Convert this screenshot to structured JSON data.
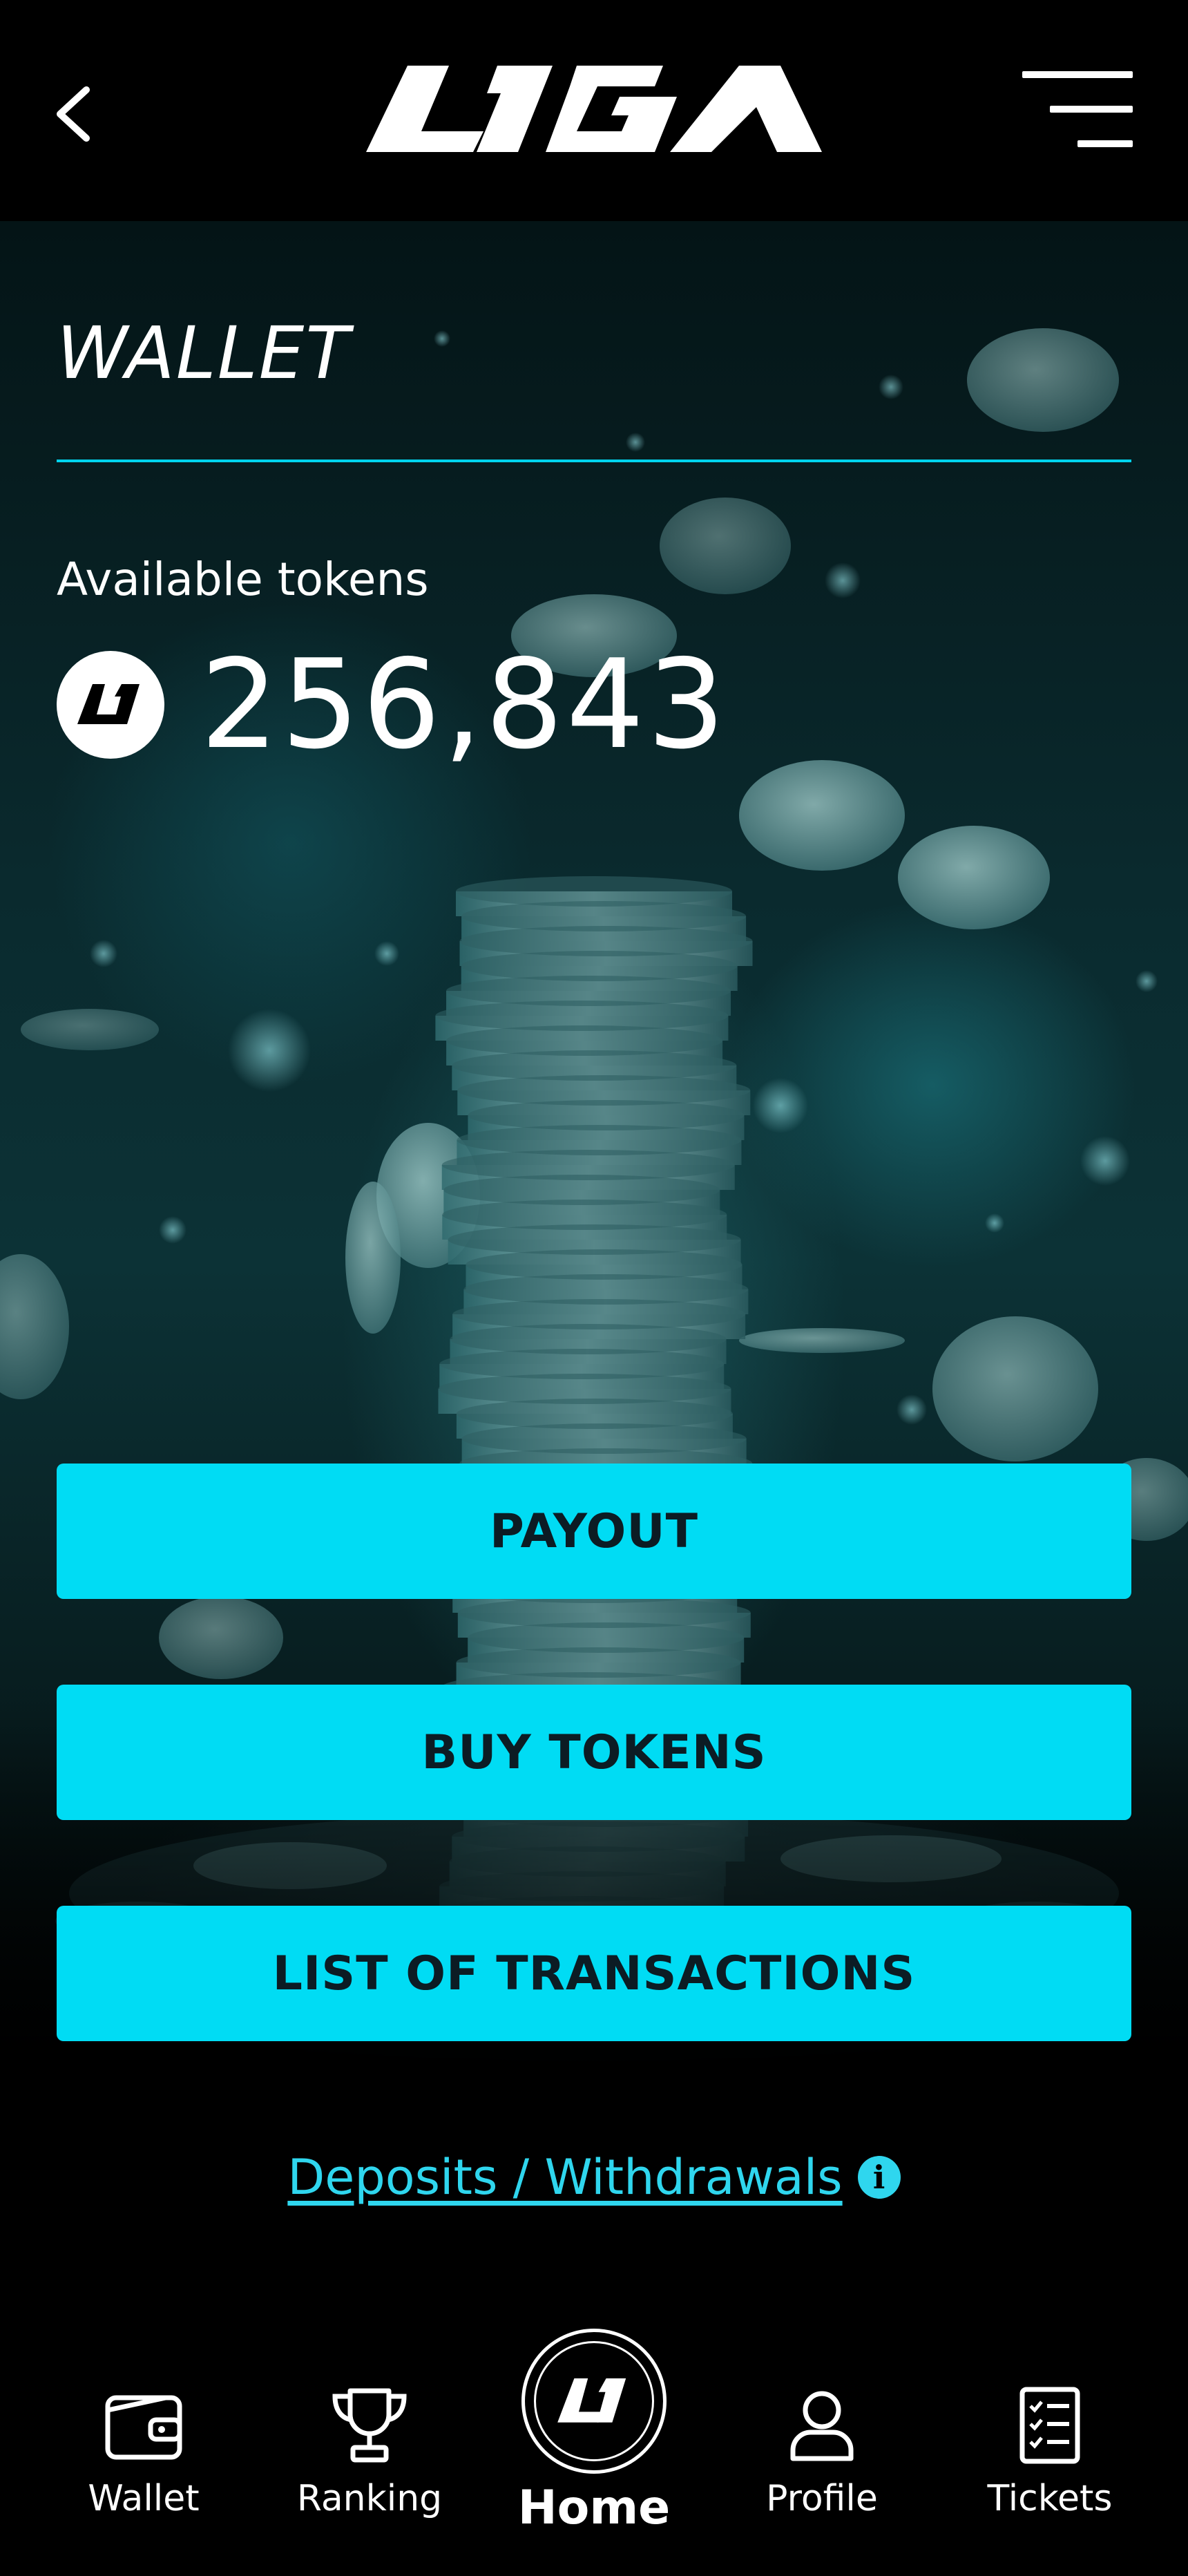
{
  "header": {
    "logo_text": "L1GA"
  },
  "wallet": {
    "title": "WALLET",
    "tokens_label": "Available tokens",
    "token_badge": "L1",
    "tokens_amount": "256,843"
  },
  "actions": {
    "payout_label": "PAYOUT",
    "buy_tokens_label": "BUY TOKENS",
    "transactions_label": "LIST OF TRANSACTIONS"
  },
  "deposits": {
    "link_label": "Deposits / Withdrawals",
    "info_icon": "i"
  },
  "nav": {
    "wallet": "Wallet",
    "ranking": "Ranking",
    "home": "Home",
    "home_badge": "L1",
    "profile": "Profile",
    "tickets": "Tickets"
  },
  "colors": {
    "accent": "#00dcf4",
    "background": "#000000",
    "button_text": "#0c1c24"
  },
  "icons": {
    "back": "chevron-left-icon",
    "menu": "hamburger-menu-icon",
    "wallet": "wallet-icon",
    "ranking": "trophy-icon",
    "profile": "user-icon",
    "tickets": "checklist-icon",
    "info": "info-icon"
  }
}
